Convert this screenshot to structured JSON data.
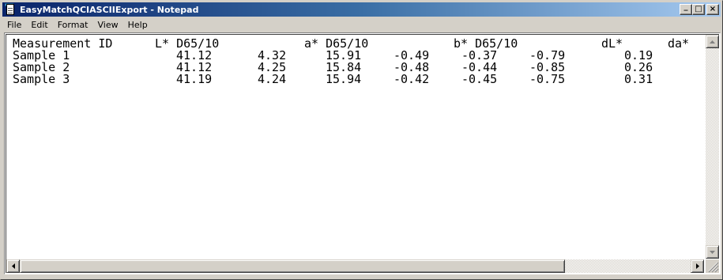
{
  "window": {
    "title": "EasyMatchQCIASCIIExport - Notepad",
    "app_icon": "notepad-icon",
    "buttons": {
      "minimize": "_",
      "maximize": "□",
      "close": "×"
    }
  },
  "menu": [
    {
      "label": "File"
    },
    {
      "label": "Edit"
    },
    {
      "label": "Format"
    },
    {
      "label": "View"
    },
    {
      "label": "Help"
    }
  ],
  "document": {
    "header": [
      "Measurement ID",
      "L* D65/10",
      "a* D65/10",
      "b* D65/10",
      "dL*",
      "da*"
    ],
    "rows": [
      {
        "id": "Sample 1",
        "values": [
          "41.12",
          "4.32",
          "15.91",
          "-0.49",
          "-0.37",
          "-0.79",
          "0.19"
        ]
      },
      {
        "id": "Sample 2",
        "values": [
          "41.12",
          "4.25",
          "15.84",
          "-0.48",
          "-0.44",
          "-0.85",
          "0.26"
        ]
      },
      {
        "id": "Sample 3",
        "values": [
          "41.19",
          "4.24",
          "15.94",
          "-0.42",
          "-0.45",
          "-0.75",
          "0.31"
        ]
      }
    ]
  },
  "scrollbars": {
    "vertical": {
      "up_icon": "triangle-up-icon",
      "down_icon": "triangle-down-icon"
    },
    "horizontal": {
      "left_icon": "triangle-left-icon",
      "right_icon": "triangle-right-icon"
    }
  },
  "colors": {
    "titlebar_start": "#0a246a",
    "titlebar_end": "#a6caf0",
    "chrome": "#d4d0c8"
  }
}
